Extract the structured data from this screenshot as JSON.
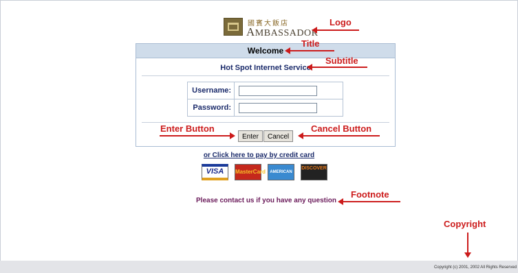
{
  "logo": {
    "cjk": "國賓大飯店",
    "word_cap": "A",
    "word_rest": "MBASSADOR"
  },
  "panel": {
    "title": "Welcome",
    "subtitle": "Hot Spot Internet Service",
    "username_label": "Username:",
    "password_label": "Password:",
    "username_value": "",
    "password_value": "",
    "enter_label": "Enter",
    "cancel_label": "Cancel"
  },
  "credit_card_link": "or Click here to pay by credit card",
  "cards": {
    "visa": "VISA",
    "mastercard": "MasterCard",
    "amex": "AMERICAN EXPRESS",
    "discover": "DISCOVER"
  },
  "footnote": "Please contact us if you have any question",
  "copyright": "Copyright (c) 2001, 2002 All Rights Reserved",
  "annotations": {
    "logo": "Logo",
    "title": "Title",
    "subtitle": "Subtitle",
    "enter_button": "Enter Button",
    "cancel_button": "Cancel Button",
    "footnote": "Footnote",
    "copyright": "Copyright"
  },
  "colors": {
    "annotation": "#cc1b1b",
    "panel_header": "#cfdcea",
    "footer": "#e3e4e8"
  }
}
